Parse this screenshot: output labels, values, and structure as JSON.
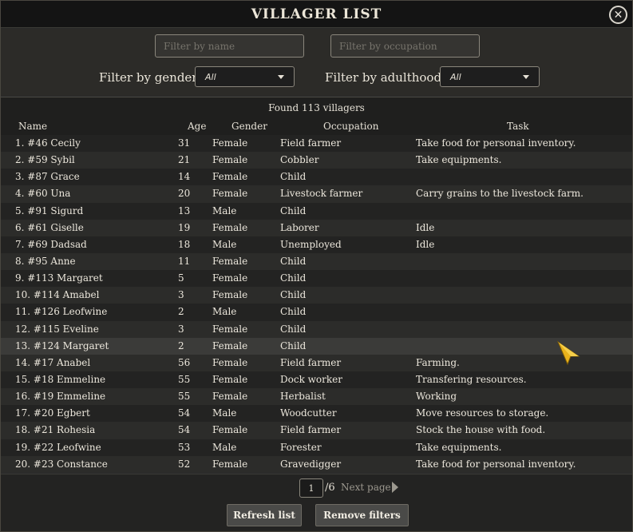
{
  "title": "VILLAGER LIST",
  "close_label": "✕",
  "filters": {
    "name_placeholder": "Filter by name",
    "occupation_placeholder": "Filter by occupation",
    "gender_label": "Filter by gender",
    "gender_value": "All",
    "adulthood_label": "Filter by adulthood",
    "adulthood_value": "All"
  },
  "found_text": "Found 113 villagers",
  "columns": {
    "name": "Name",
    "age": "Age",
    "gender": "Gender",
    "occupation": "Occupation",
    "task": "Task"
  },
  "rows": [
    {
      "name": "1. #46 Cecily",
      "age": "31",
      "gender": "Female",
      "occupation": "Field farmer",
      "task": "Take food for personal inventory."
    },
    {
      "name": "2. #59 Sybil",
      "age": "21",
      "gender": "Female",
      "occupation": "Cobbler",
      "task": "Take equipments."
    },
    {
      "name": "3. #87 Grace",
      "age": "14",
      "gender": "Female",
      "occupation": "Child",
      "task": ""
    },
    {
      "name": "4. #60 Una",
      "age": "20",
      "gender": "Female",
      "occupation": "Livestock farmer",
      "task": "Carry grains to the livestock farm."
    },
    {
      "name": "5. #91 Sigurd",
      "age": "13",
      "gender": "Male",
      "occupation": "Child",
      "task": ""
    },
    {
      "name": "6. #61 Giselle",
      "age": "19",
      "gender": "Female",
      "occupation": "Laborer",
      "task": "Idle"
    },
    {
      "name": "7. #69 Dadsad",
      "age": "18",
      "gender": "Male",
      "occupation": "Unemployed",
      "task": "Idle"
    },
    {
      "name": "8. #95 Anne",
      "age": "11",
      "gender": "Female",
      "occupation": "Child",
      "task": ""
    },
    {
      "name": "9. #113 Margaret",
      "age": "5",
      "gender": "Female",
      "occupation": "Child",
      "task": ""
    },
    {
      "name": "10. #114 Amabel",
      "age": "3",
      "gender": "Female",
      "occupation": "Child",
      "task": ""
    },
    {
      "name": "11. #126 Leofwine",
      "age": "2",
      "gender": "Male",
      "occupation": "Child",
      "task": ""
    },
    {
      "name": "12. #115 Eveline",
      "age": "3",
      "gender": "Female",
      "occupation": "Child",
      "task": ""
    },
    {
      "name": "13. #124 Margaret",
      "age": "2",
      "gender": "Female",
      "occupation": "Child",
      "task": ""
    },
    {
      "name": "14. #17 Anabel",
      "age": "56",
      "gender": "Female",
      "occupation": "Field farmer",
      "task": "Farming."
    },
    {
      "name": "15. #18 Emmeline",
      "age": "55",
      "gender": "Female",
      "occupation": "Dock worker",
      "task": "Transfering resources."
    },
    {
      "name": "16. #19 Emmeline",
      "age": "55",
      "gender": "Female",
      "occupation": "Herbalist",
      "task": "Working"
    },
    {
      "name": "17. #20 Egbert",
      "age": "54",
      "gender": "Male",
      "occupation": "Woodcutter",
      "task": "Move resources to storage."
    },
    {
      "name": "18. #21 Rohesia",
      "age": "54",
      "gender": "Female",
      "occupation": "Field farmer",
      "task": "Stock the house with food."
    },
    {
      "name": "19. #22 Leofwine",
      "age": "53",
      "gender": "Male",
      "occupation": "Forester",
      "task": "Take equipments."
    },
    {
      "name": "20. #23 Constance",
      "age": "52",
      "gender": "Female",
      "occupation": "Gravedigger",
      "task": "Take food for personal inventory."
    }
  ],
  "pager": {
    "current_page": "1",
    "total": "/6",
    "next_label": "Next page"
  },
  "buttons": {
    "refresh": "Refresh list",
    "remove_filters": "Remove filters"
  },
  "colors": {
    "cursor": "#e8b21c"
  }
}
